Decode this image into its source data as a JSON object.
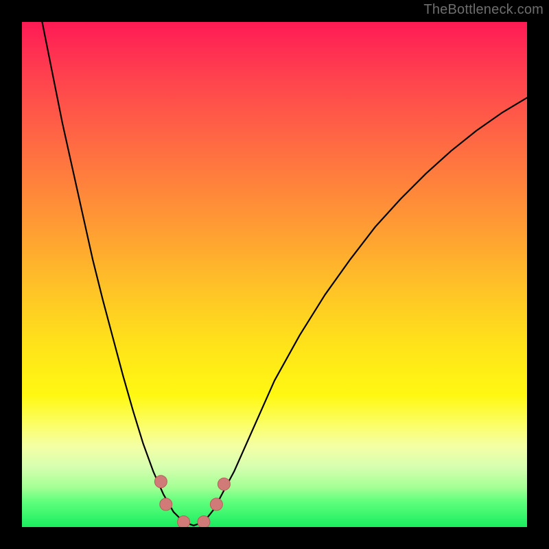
{
  "watermark": "TheBottleneck.com",
  "colors": {
    "frame": "#000000",
    "curve": "#000000",
    "marker_fill": "#d07b78",
    "marker_stroke": "#b85d5a",
    "gradient_top": "#ff1a55",
    "gradient_bottom": "#19ed5f"
  },
  "chart_data": {
    "type": "line",
    "title": "",
    "xlabel": "",
    "ylabel": "",
    "xlim": [
      0,
      100
    ],
    "ylim": [
      0,
      100
    ],
    "grid": false,
    "legend": false,
    "series": [
      {
        "name": "bottleneck-curve",
        "x": [
          4,
          6,
          8,
          10,
          12,
          14,
          16,
          18,
          20,
          22,
          24,
          26,
          28,
          30,
          32,
          34,
          36,
          38,
          42,
          46,
          50,
          55,
          60,
          65,
          70,
          75,
          80,
          85,
          90,
          95,
          100
        ],
        "y": [
          100,
          90,
          80,
          71,
          62,
          53,
          45,
          37.5,
          30,
          23,
          16.5,
          11,
          6.5,
          3,
          1,
          0.3,
          1,
          3.5,
          11,
          20,
          29,
          38,
          46,
          53,
          59.5,
          65,
          70,
          74.5,
          78.5,
          82,
          85
        ]
      }
    ],
    "markers": [
      {
        "name": "marker-left-upper",
        "x": 27.5,
        "y": 9
      },
      {
        "name": "marker-left-lower",
        "x": 28.5,
        "y": 4.5
      },
      {
        "name": "marker-valley-left",
        "x": 32,
        "y": 1
      },
      {
        "name": "marker-valley-right",
        "x": 36,
        "y": 1
      },
      {
        "name": "marker-right-lower",
        "x": 38.5,
        "y": 4.5
      },
      {
        "name": "marker-right-upper",
        "x": 40,
        "y": 8.5
      }
    ],
    "marker_radius_px": 9
  }
}
